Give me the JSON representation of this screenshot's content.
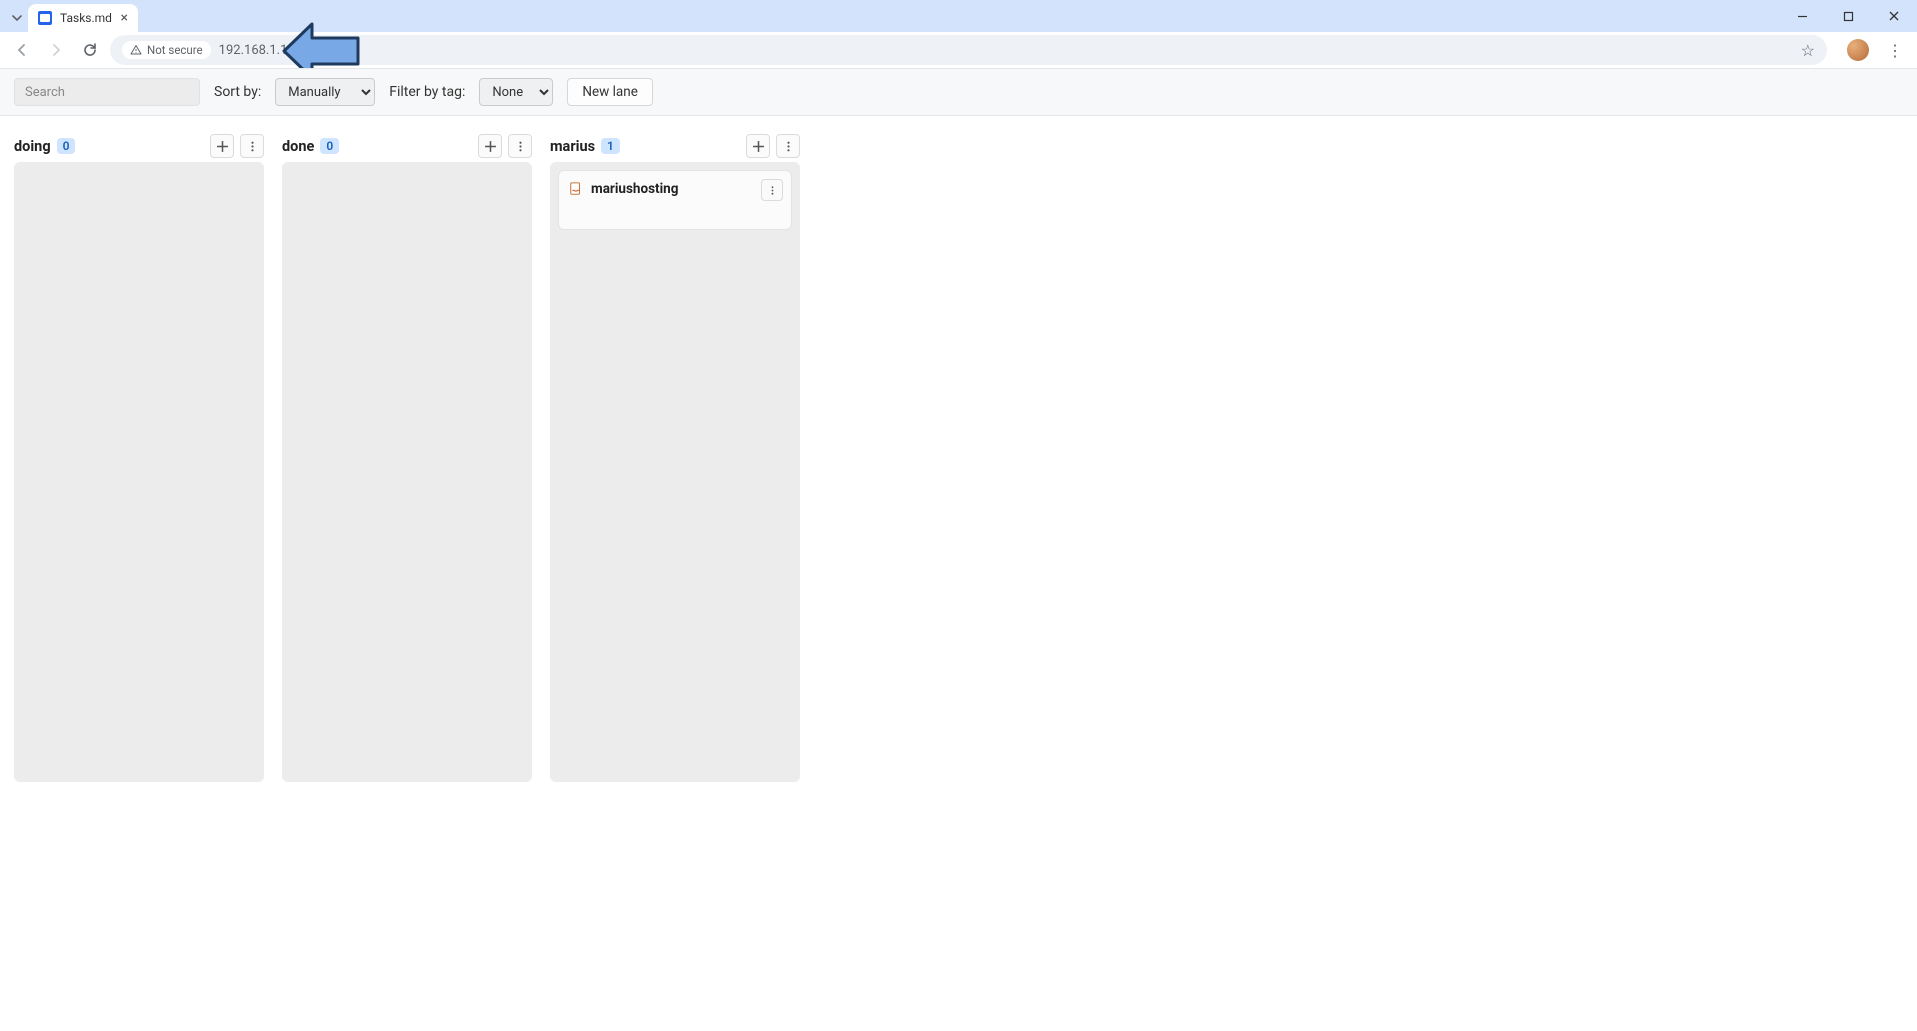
{
  "browser": {
    "tab_title": "Tasks.md",
    "not_secure_label": "Not secure",
    "url": "192.168.1.18:3563"
  },
  "toolbar": {
    "search_placeholder": "Search",
    "sort_by_label": "Sort by:",
    "sort_by_value": "Manually",
    "filter_by_tag_label": "Filter by tag:",
    "filter_by_tag_value": "None",
    "new_lane_label": "New lane"
  },
  "lanes": [
    {
      "title": "doing",
      "count": "0",
      "cards": []
    },
    {
      "title": "done",
      "count": "0",
      "cards": []
    },
    {
      "title": "marius",
      "count": "1",
      "cards": [
        {
          "title": "mariushosting"
        }
      ]
    }
  ]
}
